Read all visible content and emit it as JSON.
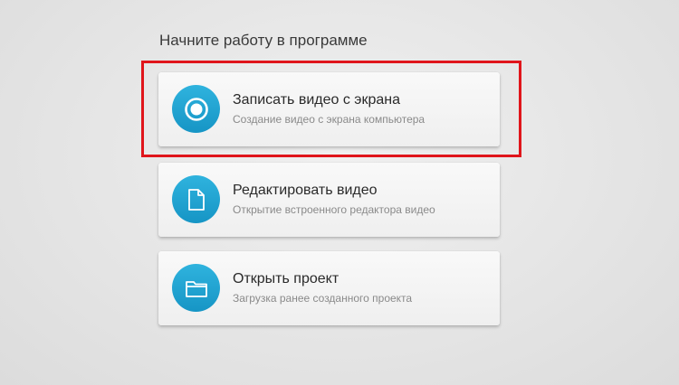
{
  "heading": "Начните работу в программе",
  "actions": [
    {
      "title": "Записать видео с экрана",
      "subtitle": "Создание видео с экрана компьютера",
      "icon": "record-icon"
    },
    {
      "title": "Редактировать видео",
      "subtitle": "Открытие встроенного редактора видео",
      "icon": "document-icon"
    },
    {
      "title": "Открыть проект",
      "subtitle": "Загрузка ранее созданного проекта",
      "icon": "folder-icon"
    }
  ],
  "colors": {
    "accent": "#1fa4d3",
    "highlight": "#e0151b",
    "background": "#e6e6e6"
  }
}
